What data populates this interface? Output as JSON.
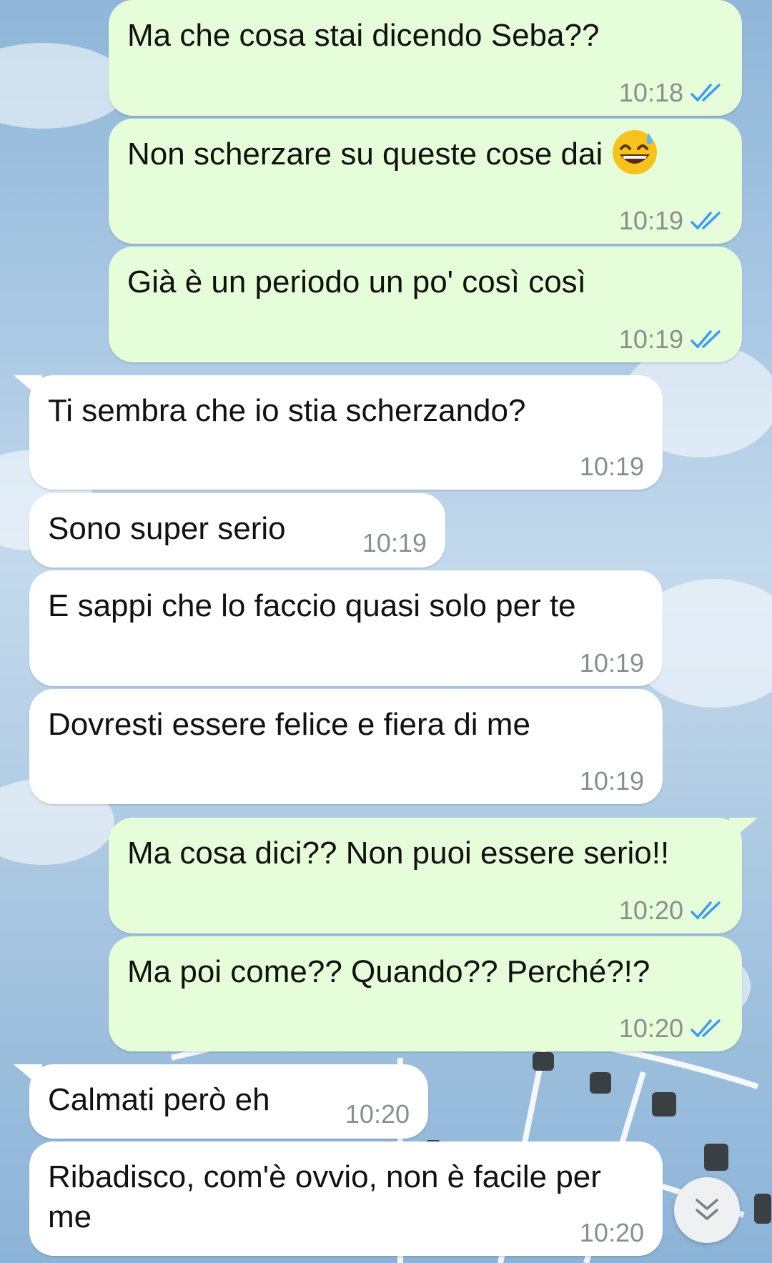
{
  "messages": [
    {
      "dir": "out",
      "text": "Ma che cosa stai dicendo Seba??",
      "time": "10:18"
    },
    {
      "dir": "out",
      "text": "Non scherzare su queste cose dai",
      "time": "10:19",
      "emoji": "grinning-sweat-emoji"
    },
    {
      "dir": "out",
      "text": "Già è un periodo un po' così così",
      "time": "10:19"
    },
    {
      "dir": "in",
      "text": "Ti sembra che io stia scherzando?",
      "time": "10:19"
    },
    {
      "dir": "in",
      "text": "Sono super serio",
      "time": "10:19"
    },
    {
      "dir": "in",
      "text": "E sappi che lo faccio quasi solo per te",
      "time": "10:19"
    },
    {
      "dir": "in",
      "text": "Dovresti essere felice e fiera di me",
      "time": "10:19"
    },
    {
      "dir": "out",
      "text": "Ma cosa dici?? Non puoi essere serio!!",
      "time": "10:20"
    },
    {
      "dir": "out",
      "text": "Ma poi come?? Quando?? Perché?!?",
      "time": "10:20"
    },
    {
      "dir": "in",
      "text": "Calmati però eh",
      "time": "10:20"
    },
    {
      "dir": "in",
      "text": "Ribadisco, com'è ovvio, non è facile per me",
      "time": "10:20"
    }
  ],
  "colors": {
    "outgoing_bubble": "#e6fdd9",
    "incoming_bubble": "#ffffff",
    "read_ticks": "#3b9cf0"
  },
  "icons": {
    "read_receipt": "double-check-icon",
    "scroll_down": "double-chevron-down-icon"
  }
}
